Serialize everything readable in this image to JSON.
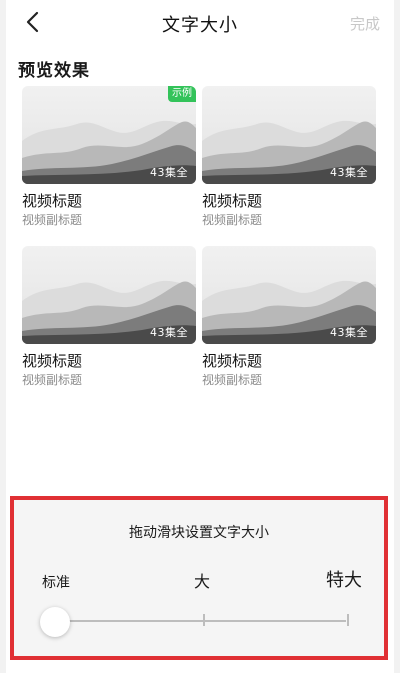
{
  "header": {
    "title": "文字大小",
    "done_label": "完成"
  },
  "preview": {
    "section_title": "预览效果",
    "example_badge": "示例",
    "cards": [
      {
        "title": "视频标题",
        "subtitle": "视频副标题",
        "count": "43集全"
      },
      {
        "title": "视频标题",
        "subtitle": "视频副标题",
        "count": "43集全"
      },
      {
        "title": "视频标题",
        "subtitle": "视频副标题",
        "count": "43集全"
      },
      {
        "title": "视频标题",
        "subtitle": "视频副标题",
        "count": "43集全"
      }
    ]
  },
  "font_size_panel": {
    "title": "拖动滑块设置文字大小",
    "levels": [
      "标准",
      "大",
      "特大"
    ],
    "selected_level": "标准",
    "accent_color": "#e03034"
  }
}
